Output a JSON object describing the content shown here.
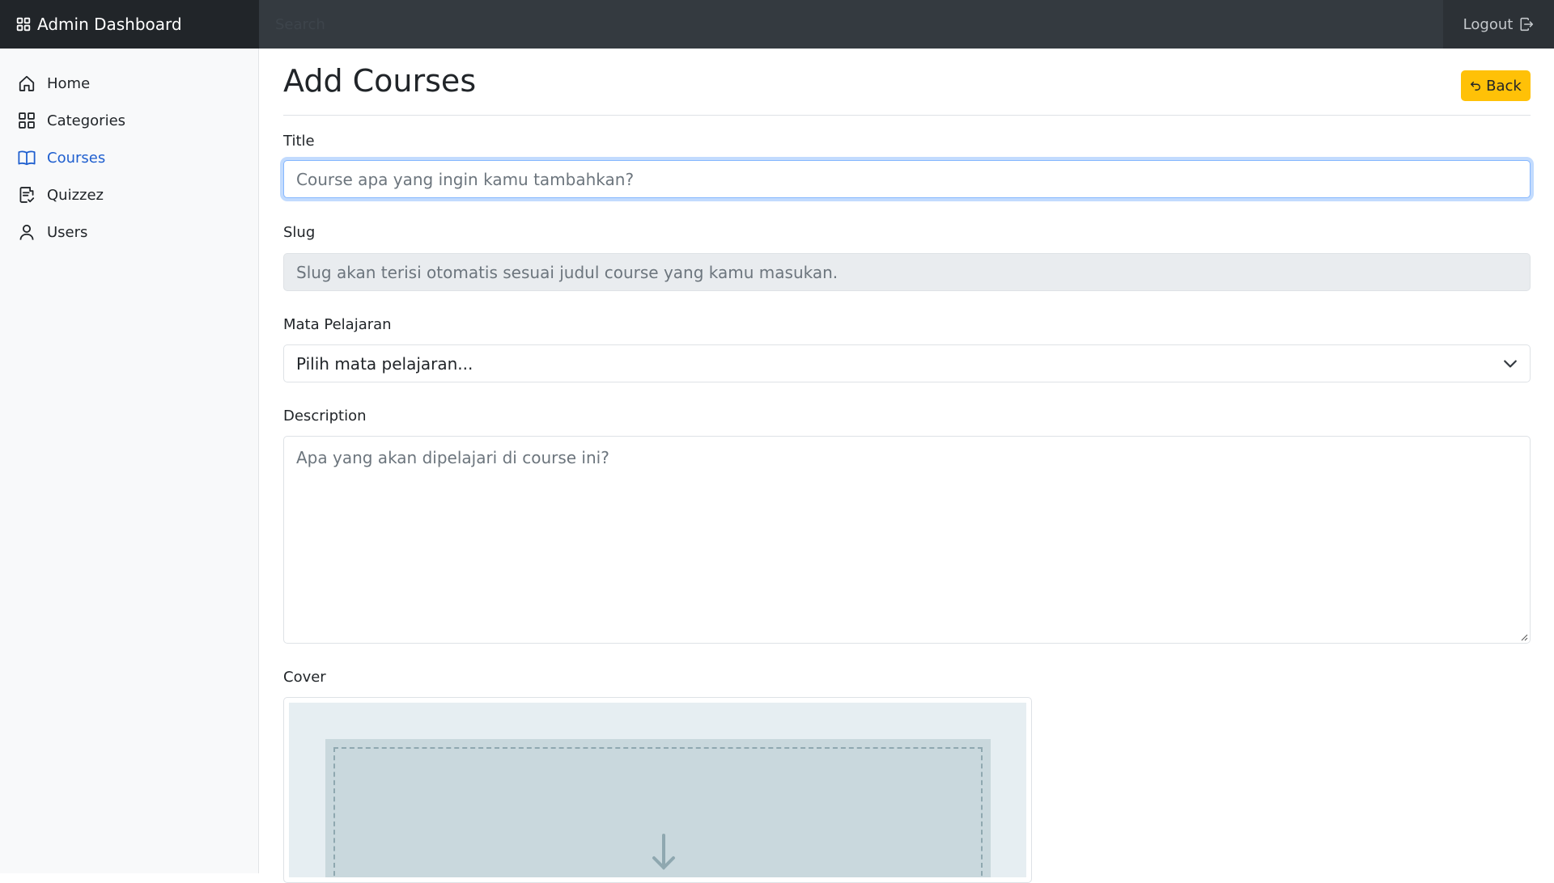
{
  "navbar": {
    "brand": "Admin Dashboard",
    "brand_icon": "grid-icon",
    "search_placeholder": "Search",
    "logout_label": "Logout",
    "logout_icon": "logout-icon"
  },
  "sidebar": {
    "items": [
      {
        "label": "Home",
        "icon": "house-icon",
        "active": false
      },
      {
        "label": "Categories",
        "icon": "grid-icon",
        "active": false
      },
      {
        "label": "Courses",
        "icon": "book-icon",
        "active": true
      },
      {
        "label": "Quizzez",
        "icon": "clipboard-check-icon",
        "active": false
      },
      {
        "label": "Users",
        "icon": "person-icon",
        "active": false
      }
    ],
    "active_color": "#1f5fcf"
  },
  "main": {
    "title": "Add Courses",
    "back_label": "Back",
    "back_color": "#ffc107",
    "form": {
      "title_label": "Title",
      "title_placeholder": "Course apa yang ingin kamu tambahkan?",
      "title_value": "",
      "slug_label": "Slug",
      "slug_placeholder": "Slug akan terisi otomatis sesuai judul course yang kamu masukan.",
      "subject_label": "Mata Pelajaran",
      "subject_selected": "Pilih mata pelajaran...",
      "description_label": "Description",
      "description_placeholder": "Apa yang akan dipelajari di course ini?",
      "cover_label": "Cover",
      "cover_icon": "upload-icon"
    }
  }
}
